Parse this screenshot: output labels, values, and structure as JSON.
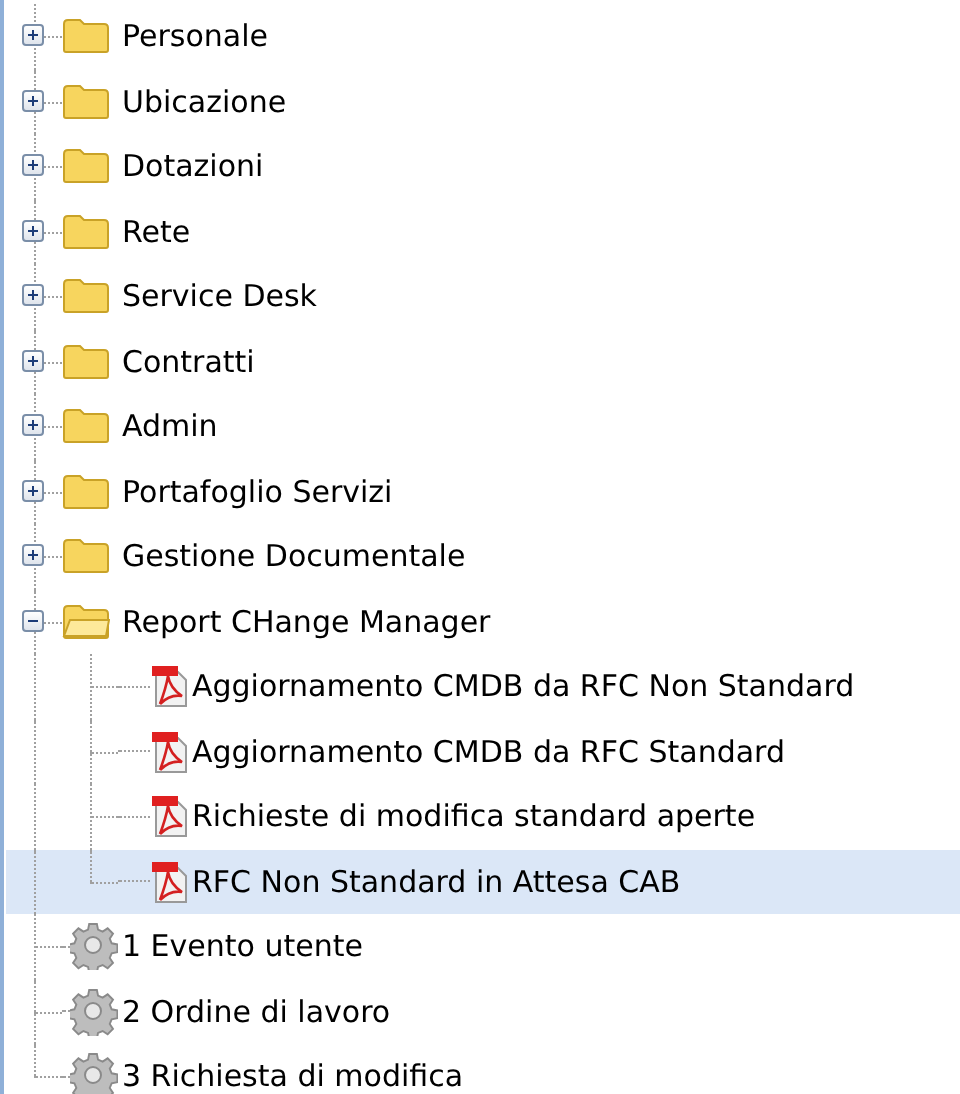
{
  "tree": {
    "items": [
      {
        "kind": "folder",
        "label": "Personale",
        "expanded": false,
        "selected": false
      },
      {
        "kind": "folder",
        "label": "Ubicazione",
        "expanded": false,
        "selected": false
      },
      {
        "kind": "folder",
        "label": "Dotazioni",
        "expanded": false,
        "selected": false
      },
      {
        "kind": "folder",
        "label": "Rete",
        "expanded": false,
        "selected": false
      },
      {
        "kind": "folder",
        "label": "Service Desk",
        "expanded": false,
        "selected": false
      },
      {
        "kind": "folder",
        "label": "Contratti",
        "expanded": false,
        "selected": false
      },
      {
        "kind": "folder",
        "label": "Admin",
        "expanded": false,
        "selected": false
      },
      {
        "kind": "folder",
        "label": "Portafoglio Servizi",
        "expanded": false,
        "selected": false
      },
      {
        "kind": "folder",
        "label": "Gestione Documentale",
        "expanded": false,
        "selected": false
      },
      {
        "kind": "folder",
        "label": "Report CHange Manager",
        "expanded": true,
        "selected": false,
        "children": [
          {
            "kind": "pdf",
            "label": "Aggiornamento CMDB da RFC Non Standard",
            "selected": false
          },
          {
            "kind": "pdf",
            "label": "Aggiornamento CMDB da RFC Standard",
            "selected": false
          },
          {
            "kind": "pdf",
            "label": "Richieste di modifica standard aperte",
            "selected": false
          },
          {
            "kind": "pdf",
            "label": "RFC Non Standard in Attesa CAB",
            "selected": true
          }
        ]
      },
      {
        "kind": "process",
        "label": "1 Evento utente",
        "selected": false
      },
      {
        "kind": "process",
        "label": "2 Ordine di lavoro",
        "selected": false
      },
      {
        "kind": "process",
        "label": "3 Richiesta di modifica",
        "selected": false
      }
    ]
  }
}
